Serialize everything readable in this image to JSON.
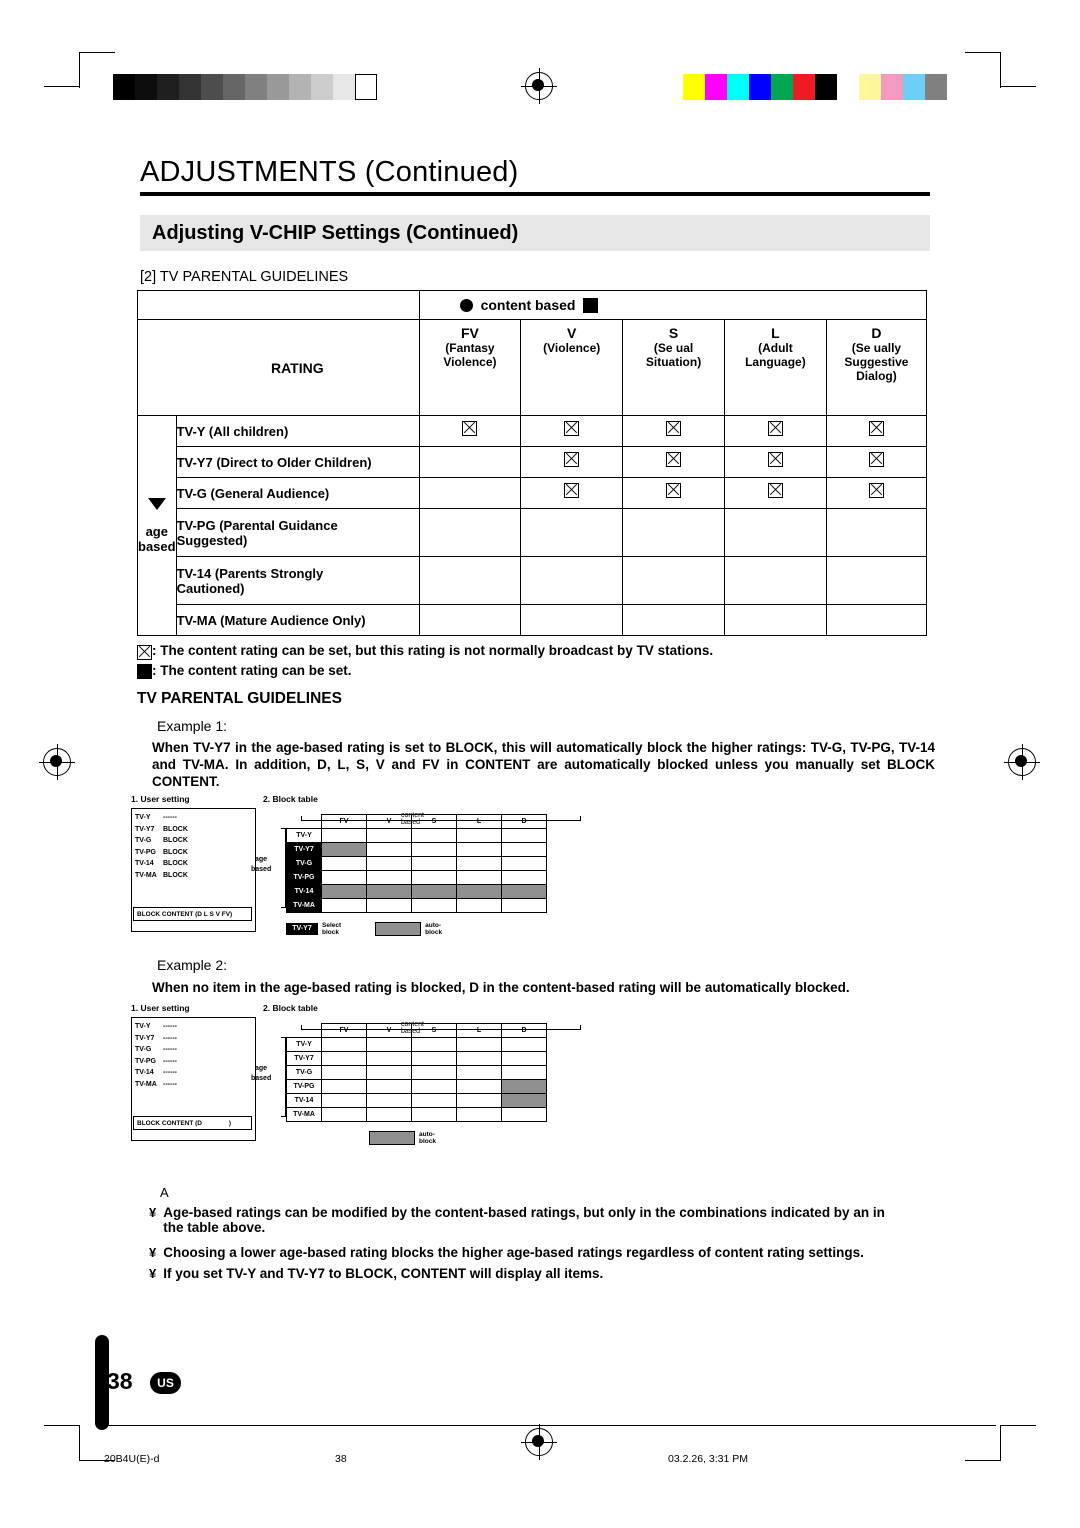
{
  "header": {
    "title": "ADJUSTMENTS (Continued)",
    "subtitle": "Adjusting V-CHIP Settings (Continued)",
    "section": "[2] TV PARENTAL GUIDELINES"
  },
  "table": {
    "content_based_label": "content based",
    "rating_header": "RATING",
    "age_label_line1": "age",
    "age_label_line2": "based",
    "columns": [
      {
        "code": "FV",
        "desc_lines": [
          "(Fantasy",
          "Violence)"
        ]
      },
      {
        "code": "V",
        "desc_lines": [
          "(Violence)"
        ]
      },
      {
        "code": "S",
        "desc_lines": [
          "(Se  ual",
          "Situation)"
        ]
      },
      {
        "code": "L",
        "desc_lines": [
          "(Adult",
          "Language)"
        ]
      },
      {
        "code": "D",
        "desc_lines": [
          "(Se  ually",
          "Suggestive",
          "Dialog)"
        ]
      }
    ],
    "rows": [
      {
        "label_bold": "TV-Y",
        "label_rest": " (All children)",
        "marks": [
          "x",
          "x",
          "x",
          "x",
          "x"
        ]
      },
      {
        "label_bold": "TV-Y7",
        "label_rest": " (Direct to Older Children)",
        "marks": [
          "",
          "x",
          "x",
          "x",
          "x"
        ]
      },
      {
        "label_bold": "TV-G",
        "label_rest": " (General Audience)",
        "marks": [
          "",
          "x",
          "x",
          "x",
          "x"
        ]
      },
      {
        "label_bold": "TV-PG",
        "label_rest": " (Parental Guidance",
        "label_line2": "Suggested)",
        "marks": [
          "",
          "",
          "",
          "",
          ""
        ]
      },
      {
        "label_bold": "TV-14",
        "label_rest": " (Parents Strongly",
        "label_line2": "Cautioned)",
        "marks": [
          "",
          "",
          "",
          "",
          ""
        ]
      },
      {
        "label_bold": "TV-MA",
        "label_rest": " (Mature Audience Only)",
        "marks": [
          "",
          "",
          "",
          "",
          ""
        ]
      }
    ]
  },
  "notes": {
    "note1": ": The content rating can be set, but this rating is not normally broadcast by TV stations.",
    "note2": ": The content rating can be set."
  },
  "tpg": {
    "heading": "TV PARENTAL GUIDELINES",
    "example1_label": "Example 1:",
    "example1_text": "When TV-Y7 in the age-based rating is set to BLOCK, this will automatically block the higher ratings: TV-G, TV-PG, TV-14 and TV-MA. In addition, D, L, S, V and FV in CONTENT are automatically blocked unless you manually set BLOCK CONTENT.",
    "example2_label": "Example 2:",
    "example2_text": "When no item in the age-based rating is blocked, D in the content-based rating will be automatically blocked."
  },
  "diagram1": {
    "user_setting_label": "1. User setting",
    "block_table_label": "2. Block table",
    "content_based_label": "content based",
    "age_label1": "age",
    "age_label2": "based",
    "ratings": [
      "TV-Y",
      "TV-Y7",
      "TV-G",
      "TV-PG",
      "TV-14",
      "TV-MA"
    ],
    "user_values": [
      "",
      "BLOCK",
      "BLOCK",
      "BLOCK",
      "BLOCK",
      "BLOCK"
    ],
    "user_dashes": "------",
    "block_content_line": "BLOCK CONTENT (D L S V FV)",
    "columns": [
      "FV",
      "V",
      "S",
      "L",
      "D"
    ],
    "select_tag": "TV-Y7",
    "select_label1": "Select",
    "select_label2": "block",
    "auto_label1": "auto-",
    "auto_label2": "block"
  },
  "diagram2": {
    "user_setting_label": "1. User setting",
    "block_table_label": "2. Block table",
    "content_based_label": "content based",
    "age_label1": "age",
    "age_label2": "based",
    "ratings": [
      "TV-Y",
      "TV-Y7",
      "TV-G",
      "TV-PG",
      "TV-14",
      "TV-MA"
    ],
    "user_dashes": "------",
    "block_content_line": "BLOCK CONTENT (D",
    "block_content_close": ")",
    "columns": [
      "FV",
      "V",
      "S",
      "L",
      "D"
    ],
    "auto_label1": "auto-",
    "auto_label2": "block"
  },
  "footnotes": {
    "a_letter": "A",
    "item1_line1": "Age-based ratings can be modified by the content-based ratings, but only in the combinations indicated by an    in",
    "item1_line2": "the table above.",
    "item2": "Choosing a lower age-based rating blocks the higher age-based ratings regardless of content rating settings.",
    "item3": "If you set TV-Y and TV-Y7 to BLOCK, CONTENT will display all items.",
    "bullet": "¥"
  },
  "footer": {
    "page_number": "38",
    "region_badge": "US",
    "file_name": "20B4U(E)-d",
    "page_ref": "38",
    "date_time": "03.2.26, 3:31 PM"
  },
  "colors": {
    "band": "#e6e6e6",
    "gray_cell": "#909090",
    "black": "#000000"
  }
}
